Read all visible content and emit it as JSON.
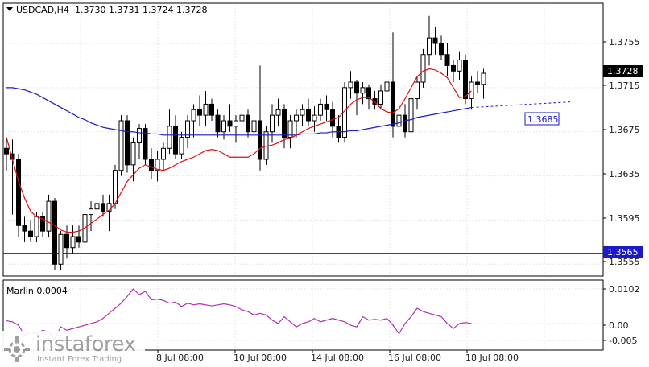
{
  "header": {
    "symbol_timeframe": "USDCAD,H4",
    "ohlc": "1.3730 1.3731 1.3724 1.3728"
  },
  "indicator": {
    "label": "Marlin 0.0004",
    "axis_labels": [
      "0.0102",
      "0.00",
      "-0.005"
    ]
  },
  "price_axis": {
    "labels": [
      "1.3755",
      "1.3715",
      "1.3675",
      "1.3635",
      "1.3595",
      "1.3555"
    ],
    "current_price": "1.3728",
    "level_marker": "1.3565",
    "ma_marker": "1.3685"
  },
  "time_axis": {
    "labels": [
      "8 Jul 08:00",
      "10 Jul 08:00",
      "14 Jul 08:00",
      "16 Jul 08:00",
      "18 Jul 08:00"
    ]
  },
  "logo": {
    "name": "instaforex",
    "tagline": "Instant Forex Trading"
  },
  "colors": {
    "bull": "#ffffff",
    "bear": "#000000",
    "ma_fast": "#e01010",
    "ma_slow": "#1a1acc",
    "level": "#1a1acc",
    "oscillator": "#b030b0",
    "grid": "#e6e6e6"
  },
  "chart_data": {
    "type": "candlestick",
    "price_range": [
      1.3545,
      1.379
    ],
    "candles": [
      [
        1.366,
        1.3668,
        1.364,
        1.3655
      ],
      [
        1.3655,
        1.3668,
        1.36,
        1.365
      ],
      [
        1.365,
        1.3655,
        1.358,
        1.359
      ],
      [
        1.359,
        1.3598,
        1.3575,
        1.3585
      ],
      [
        1.3585,
        1.3595,
        1.3575,
        1.358
      ],
      [
        1.358,
        1.3602,
        1.3575,
        1.3598
      ],
      [
        1.3598,
        1.3602,
        1.358,
        1.3585
      ],
      [
        1.3585,
        1.3618,
        1.358,
        1.3612
      ],
      [
        1.3612,
        1.3615,
        1.355,
        1.3555
      ],
      [
        1.3555,
        1.3585,
        1.355,
        1.3582
      ],
      [
        1.3582,
        1.359,
        1.356,
        1.357
      ],
      [
        1.357,
        1.359,
        1.3565,
        1.358
      ],
      [
        1.358,
        1.359,
        1.357,
        1.3575
      ],
      [
        1.3575,
        1.3605,
        1.3572,
        1.36
      ],
      [
        1.36,
        1.3612,
        1.3585,
        1.3605
      ],
      [
        1.3605,
        1.3615,
        1.3595,
        1.361
      ],
      [
        1.361,
        1.3618,
        1.3598,
        1.3603
      ],
      [
        1.3603,
        1.3618,
        1.3585,
        1.361
      ],
      [
        1.361,
        1.3645,
        1.3605,
        1.364
      ],
      [
        1.364,
        1.369,
        1.3635,
        1.3685
      ],
      [
        1.3685,
        1.369,
        1.3638,
        1.3645
      ],
      [
        1.3645,
        1.367,
        1.363,
        1.3665
      ],
      [
        1.3665,
        1.3682,
        1.365,
        1.3678
      ],
      [
        1.3678,
        1.3682,
        1.3645,
        1.365
      ],
      [
        1.365,
        1.366,
        1.3632,
        1.364
      ],
      [
        1.364,
        1.3658,
        1.363,
        1.365
      ],
      [
        1.365,
        1.3665,
        1.364,
        1.366
      ],
      [
        1.366,
        1.3695,
        1.3655,
        1.368
      ],
      [
        1.368,
        1.369,
        1.365,
        1.3655
      ],
      [
        1.3655,
        1.3675,
        1.365,
        1.367
      ],
      [
        1.367,
        1.369,
        1.366,
        1.3685
      ],
      [
        1.3685,
        1.37,
        1.367,
        1.3695
      ],
      [
        1.3695,
        1.3708,
        1.368,
        1.369
      ],
      [
        1.369,
        1.3712,
        1.368,
        1.37
      ],
      [
        1.37,
        1.3705,
        1.3685,
        1.369
      ],
      [
        1.369,
        1.3695,
        1.367,
        1.3675
      ],
      [
        1.3675,
        1.369,
        1.3668,
        1.3685
      ],
      [
        1.3685,
        1.37,
        1.3675,
        1.368
      ],
      [
        1.368,
        1.369,
        1.3665,
        1.3685
      ],
      [
        1.3685,
        1.37,
        1.3675,
        1.369
      ],
      [
        1.369,
        1.3695,
        1.367,
        1.3675
      ],
      [
        1.3675,
        1.369,
        1.366,
        1.3685
      ],
      [
        1.3685,
        1.3735,
        1.364,
        1.365
      ],
      [
        1.365,
        1.368,
        1.3645,
        1.3675
      ],
      [
        1.3675,
        1.37,
        1.3665,
        1.369
      ],
      [
        1.369,
        1.3705,
        1.368,
        1.3695
      ],
      [
        1.3695,
        1.37,
        1.366,
        1.367
      ],
      [
        1.367,
        1.369,
        1.366,
        1.3685
      ],
      [
        1.3685,
        1.3695,
        1.367,
        1.369
      ],
      [
        1.369,
        1.37,
        1.368,
        1.3695
      ],
      [
        1.3695,
        1.3705,
        1.368,
        1.3685
      ],
      [
        1.3685,
        1.3698,
        1.3675,
        1.369
      ],
      [
        1.369,
        1.3705,
        1.3685,
        1.37
      ],
      [
        1.37,
        1.3708,
        1.3685,
        1.3695
      ],
      [
        1.3695,
        1.3702,
        1.367,
        1.368
      ],
      [
        1.368,
        1.369,
        1.3665,
        1.367
      ],
      [
        1.367,
        1.372,
        1.3665,
        1.3715
      ],
      [
        1.3715,
        1.373,
        1.3705,
        1.372
      ],
      [
        1.372,
        1.3722,
        1.369,
        1.371
      ],
      [
        1.371,
        1.372,
        1.37,
        1.3715
      ],
      [
        1.3715,
        1.3718,
        1.3695,
        1.3705
      ],
      [
        1.3705,
        1.3712,
        1.3695,
        1.37
      ],
      [
        1.37,
        1.3718,
        1.3695,
        1.3712
      ],
      [
        1.3712,
        1.3725,
        1.37,
        1.372
      ],
      [
        1.372,
        1.3765,
        1.367,
        1.368
      ],
      [
        1.368,
        1.3695,
        1.367,
        1.369
      ],
      [
        1.369,
        1.37,
        1.367,
        1.3675
      ],
      [
        1.3675,
        1.3708,
        1.3675,
        1.3705
      ],
      [
        1.3705,
        1.3725,
        1.3695,
        1.372
      ],
      [
        1.372,
        1.375,
        1.3715,
        1.3745
      ],
      [
        1.3745,
        1.378,
        1.3735,
        1.376
      ],
      [
        1.376,
        1.377,
        1.3745,
        1.3755
      ],
      [
        1.3755,
        1.3762,
        1.374,
        1.3745
      ],
      [
        1.3745,
        1.3755,
        1.3725,
        1.3735
      ],
      [
        1.3735,
        1.374,
        1.372,
        1.373
      ],
      [
        1.373,
        1.3748,
        1.3722,
        1.374
      ],
      [
        1.374,
        1.3745,
        1.37,
        1.3705
      ],
      [
        1.3705,
        1.3725,
        1.3695,
        1.372
      ],
      [
        1.372,
        1.373,
        1.371,
        1.3718
      ],
      [
        1.3718,
        1.3732,
        1.3705,
        1.3728
      ]
    ],
    "ma_fast": [
      1.367,
      1.365,
      1.363,
      1.3615,
      1.3603,
      1.3598,
      1.3596,
      1.3593,
      1.359,
      1.3586,
      1.3584,
      1.3584,
      1.3585,
      1.3588,
      1.3592,
      1.3596,
      1.36,
      1.3604,
      1.361,
      1.362,
      1.363,
      1.3636,
      1.3642,
      1.3645,
      1.3643,
      1.3641,
      1.364,
      1.3642,
      1.3645,
      1.3648,
      1.365,
      1.3652,
      1.3655,
      1.3658,
      1.3659,
      1.3658,
      1.3655,
      1.3652,
      1.3652,
      1.3652,
      1.3652,
      1.3655,
      1.366,
      1.3662,
      1.3663,
      1.3665,
      1.3668,
      1.3669,
      1.3672,
      1.3675,
      1.3678,
      1.368,
      1.3682,
      1.3684,
      1.3686,
      1.3688,
      1.3694,
      1.37,
      1.3704,
      1.3706,
      1.3706,
      1.3702,
      1.3696,
      1.3693,
      1.3692,
      1.3696,
      1.3705,
      1.3715,
      1.3725,
      1.373,
      1.3732,
      1.3731,
      1.3728,
      1.3724,
      1.3715,
      1.3706,
      1.3707,
      1.3712
    ],
    "ma_slow": [
      1.3715,
      1.3715,
      1.3714,
      1.3713,
      1.3711,
      1.3709,
      1.3706,
      1.3703,
      1.37,
      1.3697,
      1.3694,
      1.3691,
      1.3688,
      1.3686,
      1.3683,
      1.3681,
      1.3679,
      1.3678,
      1.3677,
      1.3676,
      1.3675,
      1.3675,
      1.3674,
      1.3674,
      1.3673,
      1.3673,
      1.3672,
      1.3672,
      1.3672,
      1.3672,
      1.3672,
      1.3672,
      1.3672,
      1.3672,
      1.3672,
      1.3672,
      1.3672,
      1.3672,
      1.3672,
      1.3672,
      1.3672,
      1.3672,
      1.3672,
      1.3672,
      1.3672,
      1.3672,
      1.3672,
      1.3672,
      1.3672,
      1.3673,
      1.3673,
      1.3673,
      1.3674,
      1.3674,
      1.3675,
      1.3675,
      1.3675,
      1.3676,
      1.3676,
      1.3677,
      1.3678,
      1.3679,
      1.368,
      1.3681,
      1.3682,
      1.3683,
      1.3685,
      1.3686,
      1.3688,
      1.3689,
      1.369,
      1.3691,
      1.3692,
      1.3693,
      1.3694,
      1.3695,
      1.3696,
      1.3697
    ],
    "ma_projection": [
      1.3697,
      1.3702
    ],
    "horizontal_level": 1.3565,
    "oscillator_range": [
      -0.005,
      0.0102
    ],
    "oscillator": [
      0.0008,
      0.0005,
      -0.0005,
      -0.0035,
      -0.0025,
      -0.003,
      -0.002,
      -0.0025,
      -0.0045,
      -0.001,
      -0.002,
      -0.0015,
      -0.001,
      -0.0005,
      0.0,
      0.0005,
      0.0015,
      0.003,
      0.0045,
      0.006,
      0.008,
      0.0102,
      0.0085,
      0.0095,
      0.007,
      0.0072,
      0.0068,
      0.006,
      0.0063,
      0.005,
      0.006,
      0.0055,
      0.0058,
      0.0055,
      0.0052,
      0.0055,
      0.0058,
      0.0055,
      0.005,
      0.004,
      0.0035,
      0.0025,
      0.003,
      0.0025,
      0.001,
      0.0,
      0.002,
      0.0005,
      -0.001,
      0.0,
      0.0005,
      0.0015,
      0.0005,
      0.001,
      0.0015,
      0.001,
      0.0005,
      -0.0005,
      -0.001,
      0.002,
      0.001,
      0.0012,
      0.001,
      0.0015,
      -0.0005,
      -0.003,
      0.0,
      0.002,
      0.0045,
      0.0035,
      0.003,
      0.0025,
      0.002,
      0.0,
      -0.0015,
      0.0,
      0.0003,
      0.0
    ]
  }
}
